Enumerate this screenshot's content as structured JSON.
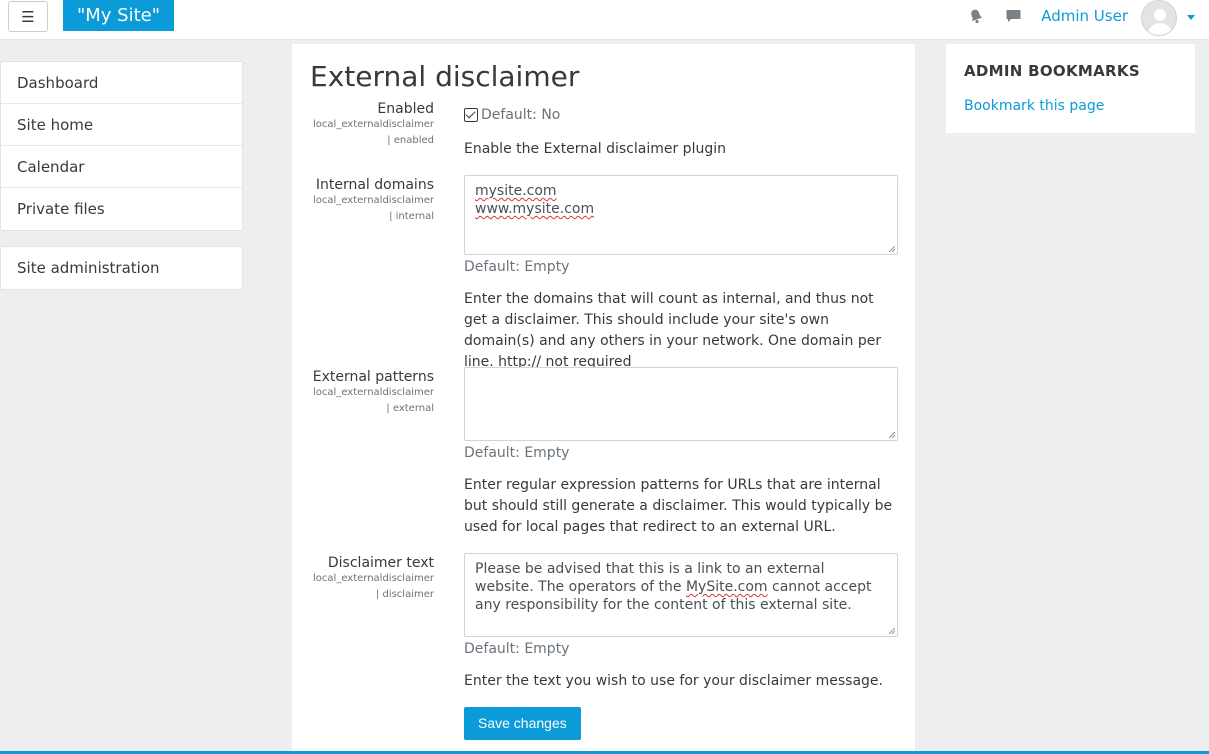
{
  "navbar": {
    "menu_icon": "hamburger-icon",
    "menu_glyph": "☰",
    "site_name": "\"My Site\"",
    "notification_icon": "bell-icon",
    "messages_icon": "chat-icon",
    "user_name": "Admin User",
    "accent_color": "#0a9bd8"
  },
  "sidebar": {
    "items": [
      {
        "label": "Dashboard"
      },
      {
        "label": "Site home"
      },
      {
        "label": "Calendar"
      },
      {
        "label": "Private files"
      }
    ],
    "admin_item": {
      "label": "Site administration"
    }
  },
  "main": {
    "title": "External disclaimer",
    "settings": {
      "enabled": {
        "label": "Enabled",
        "key_line1": "local_externaldisclaimer",
        "key_line2": "| enabled",
        "default": "Default: No",
        "checked": true,
        "description": "Enable the External disclaimer plugin"
      },
      "internal": {
        "label": "Internal domains",
        "key_line1": "local_externaldisclaimer",
        "key_line2": "| internal",
        "value_line1": "mysite.com",
        "value_line2": "www.mysite.com",
        "default": "Default: Empty",
        "description": "Enter the domains that will count as internal, and thus not get a disclaimer. This should include your site's own domain(s) and any others in your network. One domain per line. http:// not required"
      },
      "external": {
        "label": "External patterns",
        "key_line1": "local_externaldisclaimer",
        "key_line2": "| external",
        "value": "",
        "default": "Default: Empty",
        "description": "Enter regular expression patterns for URLs that are internal but should still generate a disclaimer. This would typically be used for local pages that redirect to an external URL."
      },
      "disclaimer": {
        "label": "Disclaimer text",
        "key_line1": "local_externaldisclaimer",
        "key_line2": "| disclaimer",
        "value_before": "Please be advised that this is a link to an external website. The operators of the ",
        "value_link": "MySite.com",
        "value_after": " cannot accept any responsibility for the content of this external site.",
        "default": "Default: Empty",
        "description": "Enter the text you wish to use for your disclaimer message."
      }
    },
    "save_label": "Save changes"
  },
  "right_block": {
    "title": "ADMIN BOOKMARKS",
    "link": "Bookmark this page"
  }
}
